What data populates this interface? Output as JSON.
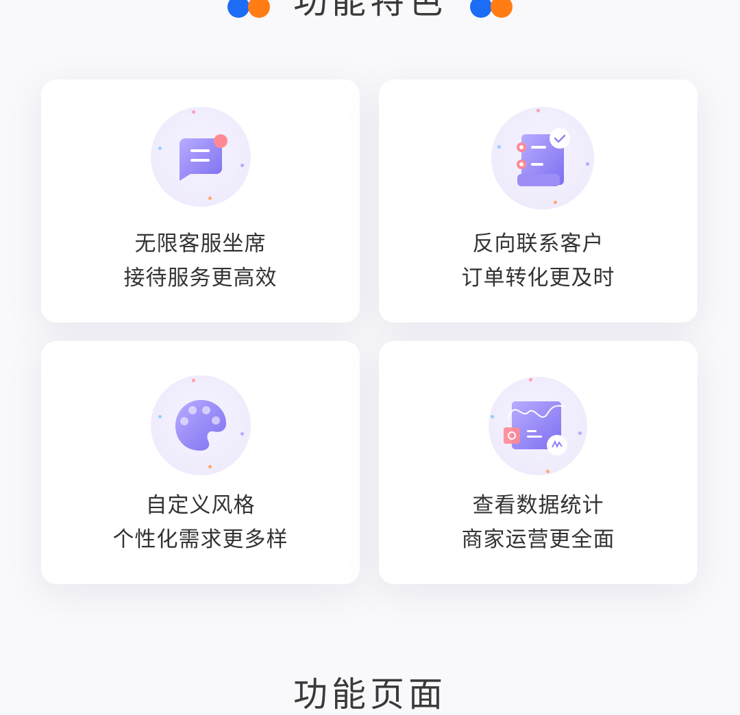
{
  "section_title": "功能特色",
  "next_section_title": "功能页面",
  "colors": {
    "brand_blue": "#1d6cf5",
    "brand_orange": "#ff7d14",
    "icon_purple": "#8f80f2",
    "accent_pink": "#ff8a95"
  },
  "features": [
    {
      "icon": "chat-bubble-icon",
      "line1": "无限客服坐席",
      "line2": "接待服务更高效"
    },
    {
      "icon": "order-list-icon",
      "line1": "反向联系客户",
      "line2": "订单转化更及时"
    },
    {
      "icon": "palette-icon",
      "line1": "自定义风格",
      "line2": "个性化需求更多样"
    },
    {
      "icon": "data-chart-icon",
      "line1": "查看数据统计",
      "line2": "商家运营更全面"
    }
  ]
}
